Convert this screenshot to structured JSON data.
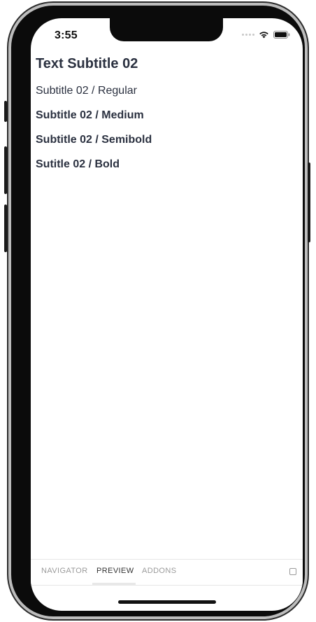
{
  "status_bar": {
    "time": "3:55",
    "wifi_icon": "wifi-icon",
    "battery_icon": "battery-icon"
  },
  "preview": {
    "title": "Text Subtitle 02",
    "lines": [
      "Subtitle 02 / Regular",
      "Subtitle 02 / Medium",
      "Subtitle 02 / Semibold",
      "Sutitle 02 / Bold"
    ]
  },
  "tabs": [
    {
      "label": "NAVIGATOR"
    },
    {
      "label": "PREVIEW"
    },
    {
      "label": "ADDONS"
    }
  ],
  "colors": {
    "text": "#2b3140",
    "device": "#0b0b0b",
    "tab_inactive": "#9a9a9a",
    "tab_active": "#333333"
  }
}
